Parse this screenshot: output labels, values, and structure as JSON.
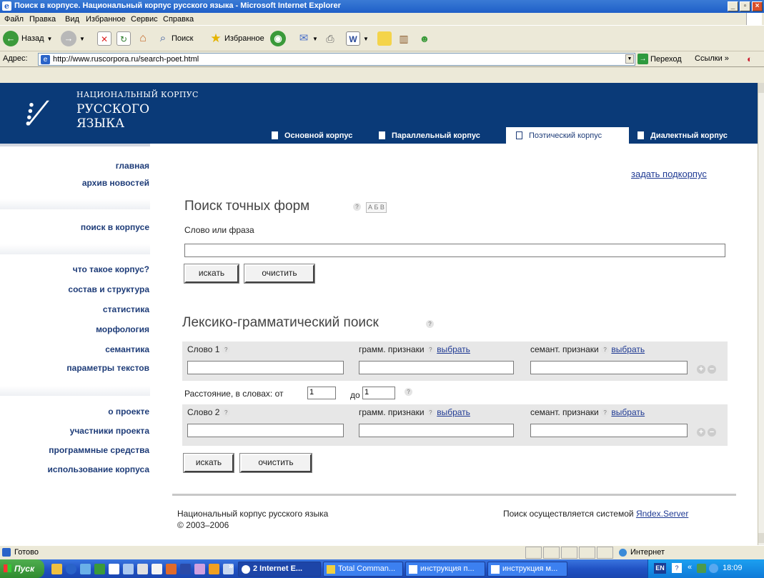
{
  "window": {
    "title": "Поиск в корпусе. Национальный корпус русского языка - Microsoft Internet Explorer",
    "controls": [
      "_",
      "▫",
      "×"
    ]
  },
  "menu": [
    "Файл",
    "Правка",
    "Вид",
    "Избранное",
    "Сервис",
    "Справка"
  ],
  "toolbar": {
    "back": "Назад",
    "search": "Поиск",
    "favorites": "Избранное"
  },
  "address": {
    "label": "Адрес:",
    "url": "http://www.ruscorpora.ru/search-poet.html",
    "go": "Переход",
    "links": "Ссылки"
  },
  "site": {
    "logo_line1": "НАЦИОНАЛЬНЫЙ КОРПУС",
    "logo_line2": "РУССКОГО",
    "logo_line3": "ЯЗЫКА",
    "tabs": [
      "Основной корпус",
      "Параллельный корпус",
      "Поэтический корпус",
      "Диалектный корпус"
    ],
    "active_tab": "Поэтический корпус"
  },
  "sidebar": {
    "group1": [
      "главная",
      "архив новостей"
    ],
    "group2": [
      "поиск в корпусе"
    ],
    "group3": [
      "что такое корпус?",
      "состав и структура",
      "статистика",
      "морфология",
      "семантика",
      "параметры текстов"
    ],
    "group4": [
      "о проекте",
      "участники проекта",
      "программные средства",
      "использование корпуса"
    ]
  },
  "content": {
    "subcorpus_link": "задать подкорпус",
    "exact": {
      "title": "Поиск точных форм",
      "keyboard": "А Б В",
      "field_label": "Слово или фраза",
      "value": "",
      "search_btn": "искать",
      "clear_btn": "очистить"
    },
    "lexgram": {
      "title": "Лексико-грамматический поиск",
      "word1_label": "Слово 1",
      "word2_label": "Слово 2",
      "gram_label": "грамм. признаки",
      "sem_label": "семант. признаки",
      "choose": "выбрать",
      "distance_label": "Расстояние, в словах: от",
      "distance_to": "до",
      "distance_from_value": "1",
      "distance_to_value": "1",
      "search_btn": "искать",
      "clear_btn": "очистить"
    },
    "footer": {
      "name": "Национальный корпус русского языка",
      "years": "© 2003–2006",
      "powered_prefix": "Поиск осуществляется системой",
      "powered_link": "Яndex.Server"
    }
  },
  "status": {
    "text": "Готово",
    "zone": "Интернет"
  },
  "taskbar": {
    "start": "Пуск",
    "tasks": [
      "2 Internet E...",
      "Total Comman...",
      "инструкция п...",
      "инструкция м..."
    ],
    "lang": "EN",
    "time": "18:09"
  }
}
